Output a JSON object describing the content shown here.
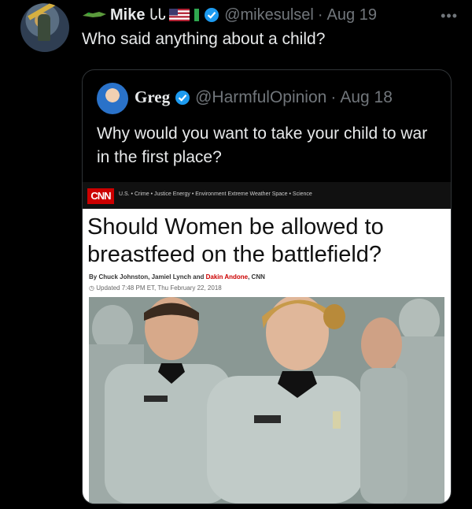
{
  "tweet": {
    "author_name": "Mike",
    "author_glyph": "ᏓᏓ",
    "handle": "@mikesulsel",
    "date": "Aug 19",
    "text": "Who said anything about a child?"
  },
  "quoted_tweet": {
    "author_name": "Greg",
    "handle": "@HarmfulOpinion",
    "date": "Aug 18",
    "text": "Why would you want to take your child to war in the first place?"
  },
  "article": {
    "logo": "CNN",
    "nav": "U.S. • Crime • Justice  Energy • Environment  Extreme Weather  Space • Science",
    "headline": "Should Women be allowed to breastfeed on the battlefield?",
    "byline_prefix": "By Chuck Johnston, Jamiel Lynch and ",
    "byline_highlight": "Dakin Andone",
    "byline_suffix": ", CNN",
    "updated": "Updated 7:48 PM ET, Thu February 22, 2018"
  },
  "colors": {
    "verified": "#1d9bf0",
    "cnn_red": "#cc0000",
    "muted": "#71767b"
  }
}
